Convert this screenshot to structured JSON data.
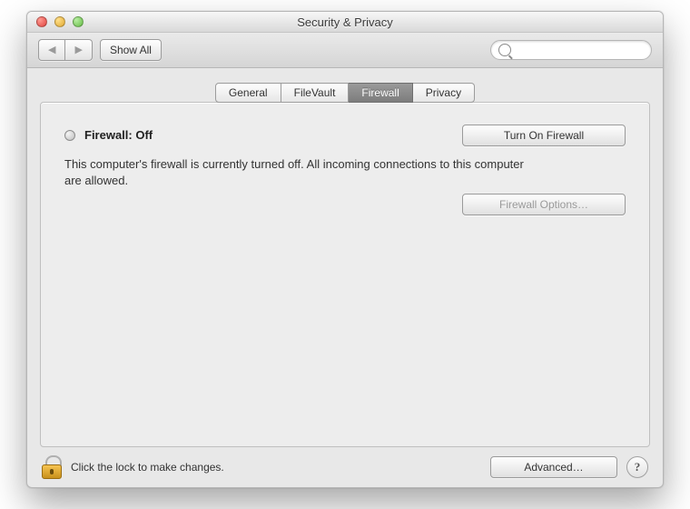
{
  "window": {
    "title": "Security & Privacy"
  },
  "toolbar": {
    "back_icon": "◀",
    "forward_icon": "▶",
    "showall_label": "Show All",
    "search_placeholder": ""
  },
  "tabs": [
    {
      "label": "General",
      "active": false
    },
    {
      "label": "FileVault",
      "active": false
    },
    {
      "label": "Firewall",
      "active": true
    },
    {
      "label": "Privacy",
      "active": false
    }
  ],
  "firewall": {
    "status_label": "Firewall: Off",
    "turn_on_label": "Turn On Firewall",
    "description": "This computer's firewall is currently turned off. All incoming connections to this computer are allowed.",
    "options_label": "Firewall Options…"
  },
  "footer": {
    "lock_hint": "Click the lock to make changes.",
    "advanced_label": "Advanced…",
    "help_label": "?"
  }
}
